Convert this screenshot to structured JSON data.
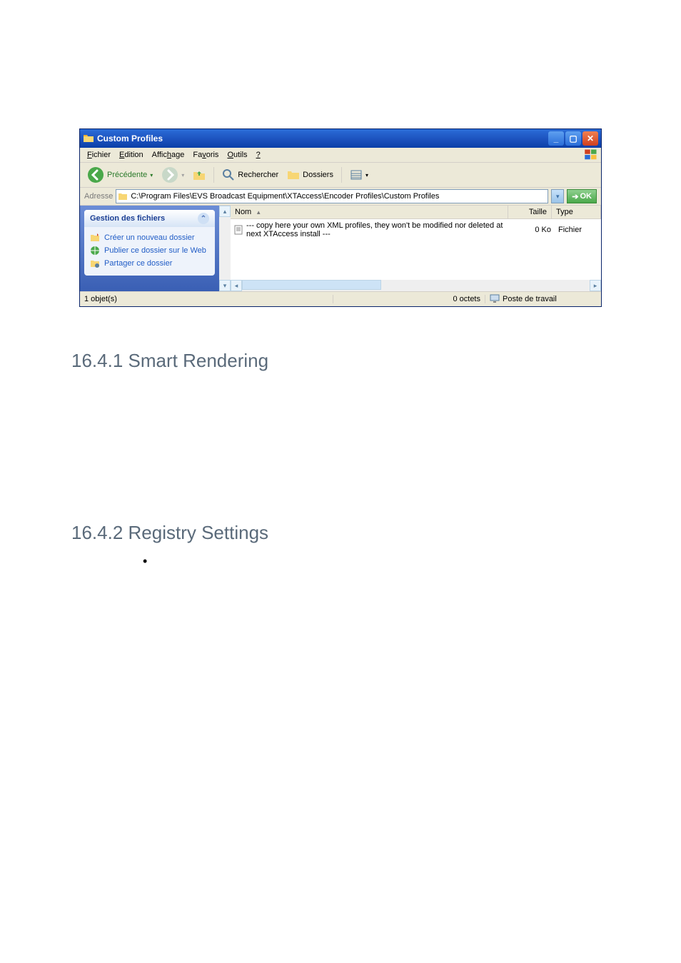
{
  "window": {
    "title": "Custom Profiles",
    "menu": {
      "file": {
        "label": "Fichier",
        "underline": "F"
      },
      "edit": {
        "label": "Edition",
        "underline": "E"
      },
      "view": {
        "label": "Affichage",
        "underline": "h"
      },
      "fav": {
        "label": "Favoris",
        "underline": "v"
      },
      "tools": {
        "label": "Outils",
        "underline": "O"
      },
      "help": {
        "label": "?",
        "underline": "?"
      }
    },
    "toolbar": {
      "back": "Précédente",
      "search": "Rechercher",
      "folders": "Dossiers"
    },
    "address": {
      "label": "Adresse",
      "path": "C:\\Program Files\\EVS Broadcast Equipment\\XTAccess\\Encoder Profiles\\Custom Profiles",
      "ok": "OK"
    },
    "columns": {
      "name": "Nom",
      "size": "Taille",
      "type": "Type"
    },
    "tasks": {
      "head": "Gestion des fichiers",
      "new": "Créer un nouveau dossier",
      "publish": "Publier ce dossier sur le Web",
      "share": "Partager ce dossier"
    },
    "files": [
      {
        "name": "--- copy here your own XML profiles, they won't be modified nor deleted at next XTAccess install ---",
        "size": "0 Ko",
        "type": "Fichier"
      }
    ],
    "status": {
      "objects": "1 objet(s)",
      "bytes": "0 octets",
      "location": "Poste de travail"
    }
  },
  "headings": {
    "h1": "16.4.1 Smart Rendering",
    "h2": "16.4.2 Registry Settings"
  }
}
